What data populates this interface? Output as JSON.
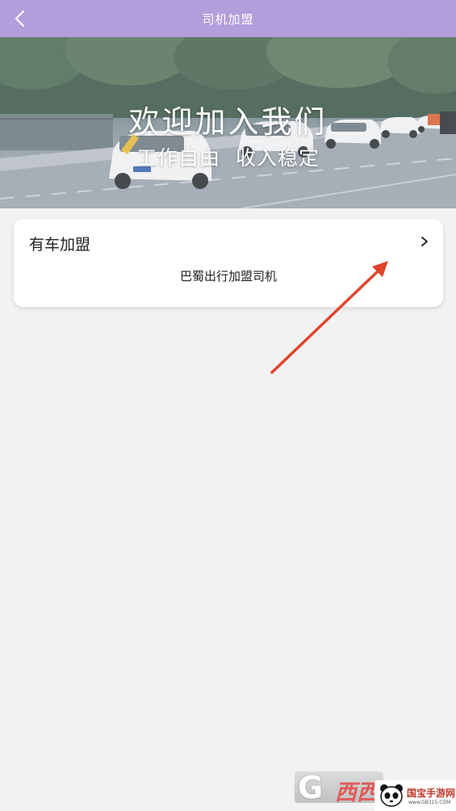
{
  "header": {
    "title": "司机加盟",
    "back_icon": "chevron-left-icon",
    "background_color": "#b39ddb"
  },
  "banner": {
    "title": "欢迎加入我们",
    "subtitle": "工作自由 收入稳定"
  },
  "join_card": {
    "title": "有车加盟",
    "subtitle": "巴蜀出行加盟司机",
    "chevron_icon": "chevron-right-icon"
  },
  "annotation": {
    "arrow_color": "#e0442c"
  },
  "watermarks": {
    "right_brand": "国宝手游网",
    "right_url": "www.GB315.COM"
  }
}
